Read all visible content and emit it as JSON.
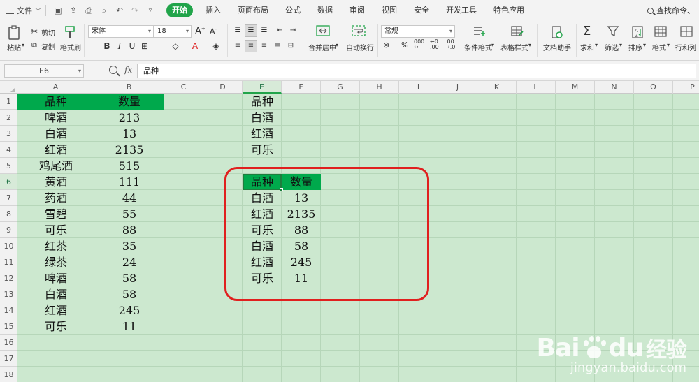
{
  "menubar": {
    "file_label": "文件",
    "tabs": [
      {
        "label": "开始",
        "active": true
      },
      {
        "label": "插入"
      },
      {
        "label": "页面布局"
      },
      {
        "label": "公式"
      },
      {
        "label": "数据"
      },
      {
        "label": "审阅"
      },
      {
        "label": "视图"
      },
      {
        "label": "安全"
      },
      {
        "label": "开发工具"
      },
      {
        "label": "特色应用"
      }
    ],
    "search_label": "查找命令、"
  },
  "ribbon": {
    "paste": "粘贴",
    "cut": "剪切",
    "copy": "复制",
    "format_painter": "格式刷",
    "font_name": "宋体",
    "font_size": "18",
    "merge_center": "合并居中",
    "auto_wrap": "自动换行",
    "number_format": "常规",
    "conditional_format": "条件格式",
    "table_style": "表格样式",
    "doc_assistant": "文档助手",
    "sum": "求和",
    "filter": "筛选",
    "sort": "排序",
    "format": "格式",
    "row_col": "行和列"
  },
  "formulabar": {
    "cell_ref": "E6",
    "fx": "fx",
    "content": "品种"
  },
  "columns": [
    "A",
    "B",
    "C",
    "D",
    "E",
    "F",
    "G",
    "H",
    "I",
    "J",
    "K",
    "L",
    "M",
    "N",
    "O",
    "P"
  ],
  "rows": [
    "1",
    "2",
    "3",
    "4",
    "5",
    "6",
    "7",
    "8",
    "9",
    "10",
    "11",
    "12",
    "13",
    "14",
    "15",
    "16",
    "17",
    "18"
  ],
  "selected_col": "E",
  "selected_row": "6",
  "table_main": {
    "headers": [
      "品种",
      "数量"
    ],
    "rows": [
      [
        "啤酒",
        "213"
      ],
      [
        "白酒",
        "13"
      ],
      [
        "红酒",
        "2135"
      ],
      [
        "鸡尾酒",
        "515"
      ],
      [
        "黄酒",
        "111"
      ],
      [
        "药酒",
        "44"
      ],
      [
        "雪碧",
        "55"
      ],
      [
        "可乐",
        "88"
      ],
      [
        "红茶",
        "35"
      ],
      [
        "绿茶",
        "24"
      ],
      [
        "啤酒",
        "58"
      ],
      [
        "白酒",
        "58"
      ],
      [
        "红酒",
        "245"
      ],
      [
        "可乐",
        "11"
      ]
    ]
  },
  "criteria_list": {
    "header": "品种",
    "items": [
      "白酒",
      "红酒",
      "可乐"
    ]
  },
  "result_table": {
    "headers": [
      "品种",
      "数量"
    ],
    "rows": [
      [
        "白酒",
        "13"
      ],
      [
        "红酒",
        "2135"
      ],
      [
        "可乐",
        "88"
      ],
      [
        "白酒",
        "58"
      ],
      [
        "红酒",
        "245"
      ],
      [
        "可乐",
        "11"
      ]
    ]
  },
  "watermark": {
    "logo_left": "Bai",
    "logo_right": "du",
    "logo_cn": "经验",
    "sub": "jingyan.baidu.com"
  },
  "colors": {
    "sheet_bg": "#cce8cf",
    "header_fill": "#00a94c",
    "accent": "#21a44a",
    "highlight_ring": "#e0201f"
  }
}
